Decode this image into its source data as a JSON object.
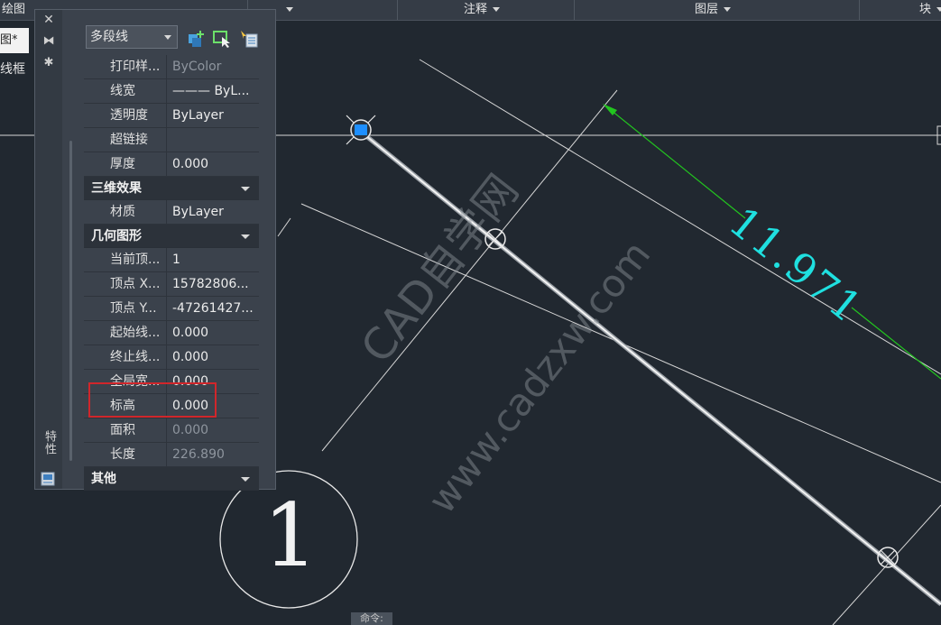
{
  "ribbon": {
    "tabs": [
      {
        "label": "绘图",
        "arrow": false
      },
      {
        "label": "",
        "arrow": true
      },
      {
        "label": "注释",
        "arrow": true
      },
      {
        "label": "图层",
        "arrow": true
      },
      {
        "label": "块",
        "arrow": true
      }
    ]
  },
  "left": {
    "doc_tab": "图*",
    "label": "线框"
  },
  "palette": {
    "side_title": "特性",
    "object_type": "多段线",
    "groups": [
      {
        "kind": "row",
        "key": "打印样...",
        "value": "ByColor",
        "dim_value": true
      },
      {
        "kind": "row",
        "key": "线宽",
        "value": "——— ByL...",
        "dim_value": false
      },
      {
        "kind": "row",
        "key": "透明度",
        "value": "ByLayer",
        "dim_value": false
      },
      {
        "kind": "row",
        "key": "超链接",
        "value": "",
        "dim_value": false
      },
      {
        "kind": "row",
        "key": "厚度",
        "value": "0.000",
        "dim_value": false
      },
      {
        "kind": "cat",
        "key": "三维效果"
      },
      {
        "kind": "row",
        "key": "材质",
        "value": "ByLayer",
        "dim_value": false
      },
      {
        "kind": "cat",
        "key": "几何图形"
      },
      {
        "kind": "row",
        "key": "当前顶...",
        "value": "1",
        "dim_value": false
      },
      {
        "kind": "row",
        "key": "顶点 X...",
        "value": "15782806...",
        "dim_value": false
      },
      {
        "kind": "row",
        "key": "顶点 Y...",
        "value": "-47261427...",
        "dim_value": false
      },
      {
        "kind": "row",
        "key": "起始线...",
        "value": "0.000",
        "dim_value": false
      },
      {
        "kind": "row",
        "key": "终止线...",
        "value": "0.000",
        "dim_value": false
      },
      {
        "kind": "row",
        "key": "全局宽...",
        "value": "0.000",
        "dim_value": false
      },
      {
        "kind": "row",
        "key": "标高",
        "value": "0.000",
        "dim_value": false
      },
      {
        "kind": "row",
        "key": "面积",
        "value": "0.000",
        "dim_value": true
      },
      {
        "kind": "row",
        "key": "长度",
        "value": "226.890",
        "dim_value": true
      },
      {
        "kind": "cat",
        "key": "其他"
      }
    ]
  },
  "drawing": {
    "dimension_text": "11.971",
    "balloon_text": "1",
    "watermark_line1": "CAD自学网",
    "watermark_line2": "www.cadzxw.com",
    "dimension_color": "#1fe0e0",
    "dim_line_color": "#22c51f",
    "grip_color": "#1e8fff"
  },
  "status": {
    "command_label": "命令:"
  }
}
